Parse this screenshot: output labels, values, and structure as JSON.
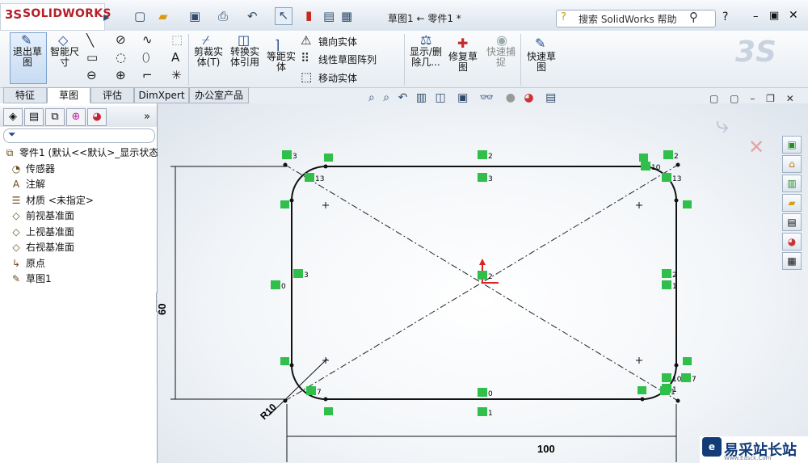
{
  "app": {
    "logo": "SOLIDWORKS",
    "doc_title": "草图1 ← 零件1 *"
  },
  "help": {
    "placeholder": "搜索 SolidWorks 帮助"
  },
  "ribbon": {
    "exit_sketch": "退出草图",
    "smart_dimension": "智能尺寸",
    "trim": "剪裁实体(T)",
    "convert": "转换实体引用",
    "offset": "等距实体",
    "mirror": "镜向实体",
    "linear_pattern": "线性草图阵列",
    "move": "移动实体",
    "display_delete": "显示/删除几...",
    "repair": "修复草图",
    "quick_snap": "快速捕捉",
    "rapid_sketch": "快速草图"
  },
  "tabs": [
    "特征",
    "草图",
    "评估",
    "DimXpert",
    "办公室产品"
  ],
  "active_tab": "草图",
  "tree": [
    {
      "icon": "part-icon",
      "label": "零件1  (默认<<默认>_显示状态"
    },
    {
      "icon": "sensor-icon",
      "label": "传感器"
    },
    {
      "icon": "annotation-icon",
      "label": "注解"
    },
    {
      "icon": "material-icon",
      "label": "材质 <未指定>"
    },
    {
      "icon": "plane-icon",
      "label": "前视基准面"
    },
    {
      "icon": "plane-icon",
      "label": "上视基准面"
    },
    {
      "icon": "plane-icon",
      "label": "右视基准面"
    },
    {
      "icon": "origin-icon",
      "label": "原点"
    },
    {
      "icon": "sketch-icon",
      "label": "草图1"
    }
  ],
  "sketch": {
    "dim_width": "100",
    "dim_height": "60",
    "dim_radius": "R10",
    "relations": [
      "3",
      "2",
      "2",
      "13",
      "3",
      "10",
      "13",
      "3",
      "2",
      "0",
      "1",
      "2",
      "1",
      "10",
      "7",
      "7",
      "0",
      "1",
      "1"
    ]
  },
  "watermark": {
    "title": "易采站长站",
    "subtitle": "Www.Easck.Com"
  },
  "colors": {
    "relation_green": "#2fbf4a",
    "logo_red": "#b3202a",
    "accent_blue": "#123c78"
  }
}
